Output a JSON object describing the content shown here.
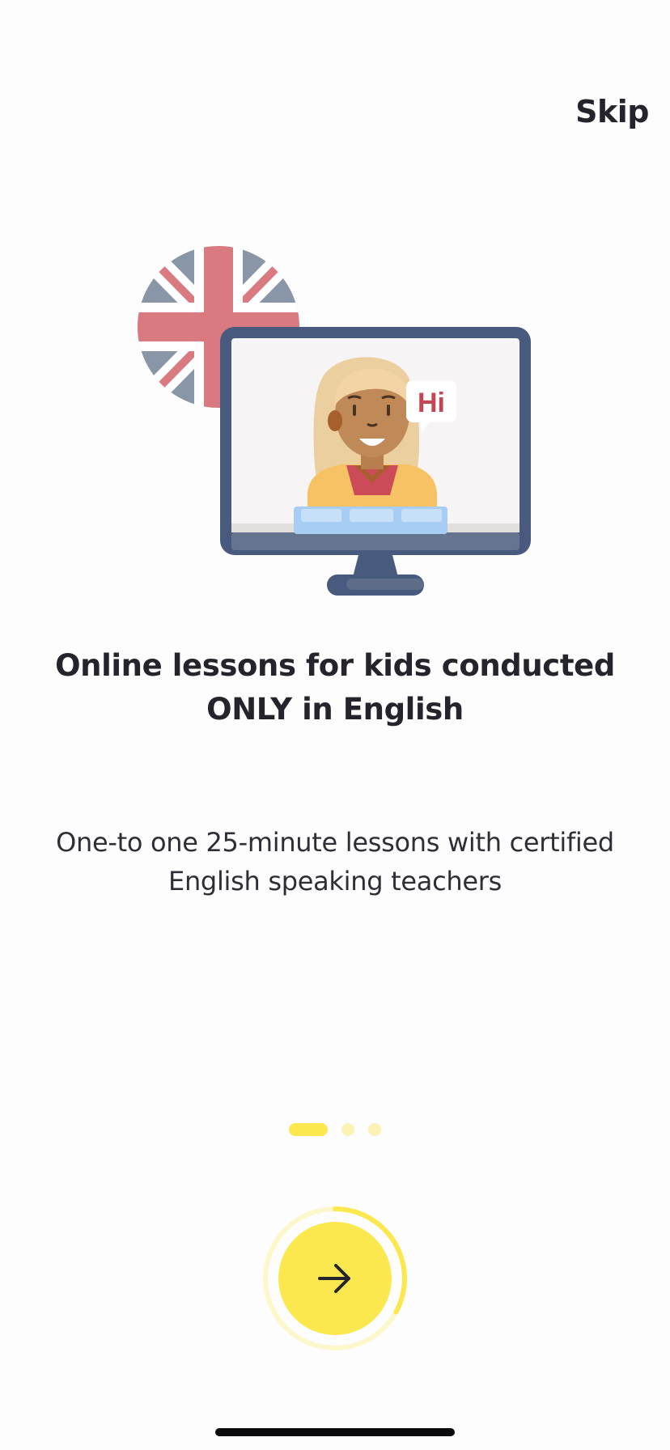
{
  "header": {
    "skip_label": "Skip"
  },
  "onboarding": {
    "title": "Online lessons for kids conducted ONLY in English",
    "subtitle": "One-to one 25-minute lessons with certified English speaking teachers",
    "illustration": {
      "speech_bubble_text": "Hi"
    },
    "pager": {
      "current_page": 1,
      "total_pages": 3
    },
    "progress": {
      "fraction": 0.33
    }
  },
  "icons": {
    "next": "arrow-right-icon"
  },
  "colors": {
    "accent": "#fbe84f",
    "accent_light": "#fbf2b6",
    "text": "#25232b",
    "monitor": "#485a7e",
    "flag_red": "#d97a80",
    "flag_blue": "#8896a8"
  }
}
